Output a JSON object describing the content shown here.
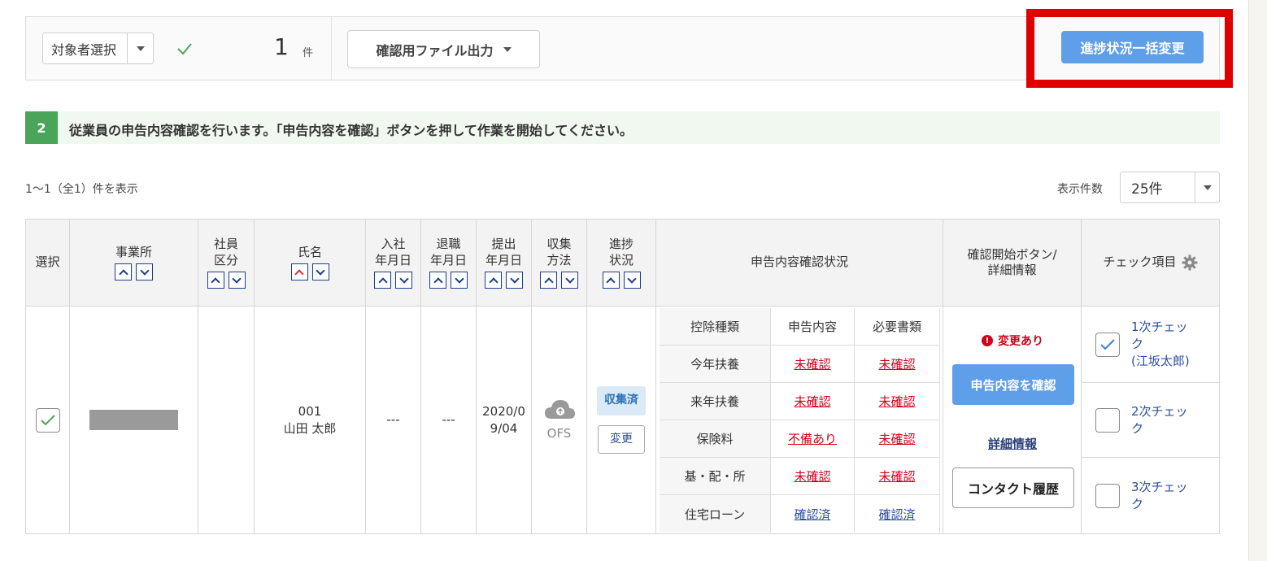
{
  "toolbar": {
    "target_select": "対象者選択",
    "count": "1",
    "count_unit": "件",
    "export_button": "確認用ファイル出力",
    "bulk_change_button": "進捗状況一括変更"
  },
  "step": {
    "number": "2",
    "text": "従業員の申告内容確認を行います。「申告内容を確認」ボタンを押して作業を開始してください。"
  },
  "listing": {
    "range_text": "1〜1（全1）件を表示",
    "per_page_label": "表示件数",
    "per_page_value": "25件"
  },
  "columns": {
    "select": "選択",
    "office": "事業所",
    "employee_type_1": "社員",
    "employee_type_2": "区分",
    "name": "氏名",
    "hire_1": "入社",
    "hire_2": "年月日",
    "retire_1": "退職",
    "retire_2": "年月日",
    "submit_1": "提出",
    "submit_2": "年月日",
    "collect_1": "収集",
    "collect_2": "方法",
    "progress_1": "進捗",
    "progress_2": "状況",
    "status": "申告内容確認状況",
    "detail_1": "確認開始ボタン/",
    "detail_2": "詳細情報",
    "check_items": "チェック項目"
  },
  "row": {
    "employee_no": "001",
    "name": "山田 太郎",
    "hire_date": "---",
    "retire_date": "---",
    "submit_date_1": "2020/0",
    "submit_date_2": "9/04",
    "collect_method": "OFS",
    "progress_tag": "収集済",
    "change_button": "変更",
    "status_table": {
      "headers": [
        "控除種類",
        "申告内容",
        "必要書類"
      ],
      "rows": [
        {
          "type": "今年扶養",
          "content": "未確認",
          "docs": "未確認"
        },
        {
          "type": "来年扶養",
          "content": "未確認",
          "docs": "未確認"
        },
        {
          "type": "保険料",
          "content": "不備あり",
          "docs": "未確認"
        },
        {
          "type": "基・配・所",
          "content": "未確認",
          "docs": "未確認"
        },
        {
          "type": "住宅ローン",
          "content": "確認済",
          "docs": "確認済"
        }
      ]
    },
    "changed_label": "変更あり",
    "confirm_button": "申告内容を確認",
    "detail_link": "詳細情報",
    "contact_button": "コンタクト履歴",
    "checks": [
      {
        "line1": "1次チェッ",
        "line2": "ク",
        "line3": "(江坂太郎)",
        "checked": true
      },
      {
        "line1": "2次チェッ",
        "line2": "ク",
        "checked": false
      },
      {
        "line1": "3次チェッ",
        "line2": "ク",
        "checked": false
      }
    ]
  },
  "colors": {
    "accent_blue": "#5f9ee8",
    "highlight_red": "#e00000",
    "step_green": "#4aa55a",
    "link_red": "#d0021b",
    "link_blue": "#2b4fa0"
  }
}
